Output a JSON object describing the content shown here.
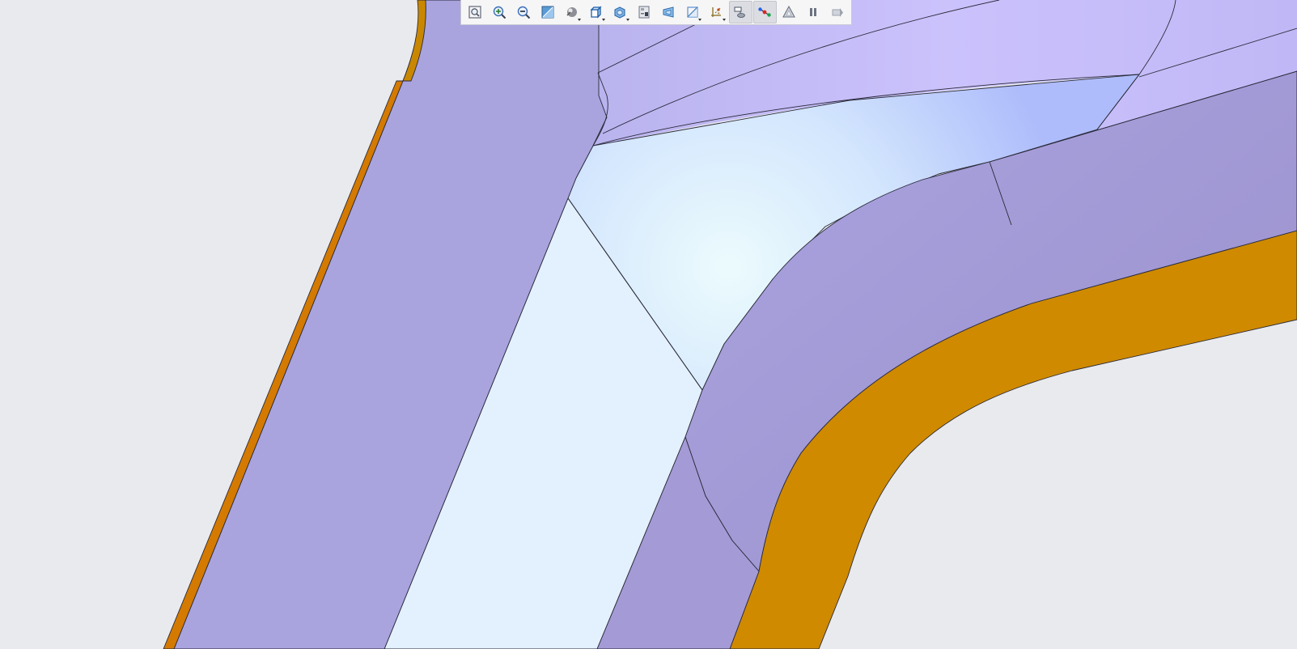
{
  "app": {
    "view": "3d-model-viewport"
  },
  "colors": {
    "background": "#e9eaed",
    "solid_face": "#a9a3de",
    "light_face": "#e3f0fd",
    "highlight_face": "#c8c0fb",
    "orange_edge": "#cf8a00",
    "edge_line": "#2a2a3a"
  },
  "toolbar": {
    "buttons": [
      {
        "name": "zoom-fit-button",
        "icon": "zoom-fit-icon",
        "active": false,
        "dropdown": false
      },
      {
        "name": "zoom-in-button",
        "icon": "zoom-in-icon",
        "active": false,
        "dropdown": false
      },
      {
        "name": "zoom-out-button",
        "icon": "zoom-out-icon",
        "active": false,
        "dropdown": false
      },
      {
        "name": "zoom-window-button",
        "icon": "zoom-window-icon",
        "active": false,
        "dropdown": false
      },
      {
        "name": "display-style-button",
        "icon": "display-style-icon",
        "active": false,
        "dropdown": true
      },
      {
        "name": "view-orientation-button",
        "icon": "cube-icon",
        "active": false,
        "dropdown": true
      },
      {
        "name": "saved-views-button",
        "icon": "saved-views-icon",
        "active": false,
        "dropdown": true
      },
      {
        "name": "view-manager-button",
        "icon": "view-manager-icon",
        "active": false,
        "dropdown": false
      },
      {
        "name": "perspective-button",
        "icon": "perspective-icon",
        "active": false,
        "dropdown": false
      },
      {
        "name": "section-button",
        "icon": "section-icon",
        "active": false,
        "dropdown": true
      },
      {
        "name": "datum-display-button",
        "icon": "datum-display-icon",
        "active": false,
        "dropdown": true
      },
      {
        "name": "annotation-display-button",
        "icon": "annotation-display-icon",
        "active": true,
        "dropdown": false
      },
      {
        "name": "spin-center-button",
        "icon": "spin-center-icon",
        "active": true,
        "dropdown": false
      },
      {
        "name": "appearance-button",
        "icon": "appearance-icon",
        "active": false,
        "dropdown": false
      },
      {
        "name": "pause-button",
        "icon": "pause-icon",
        "active": false,
        "dropdown": false
      },
      {
        "name": "regenerate-button",
        "icon": "regenerate-icon",
        "active": false,
        "dropdown": false
      }
    ]
  }
}
